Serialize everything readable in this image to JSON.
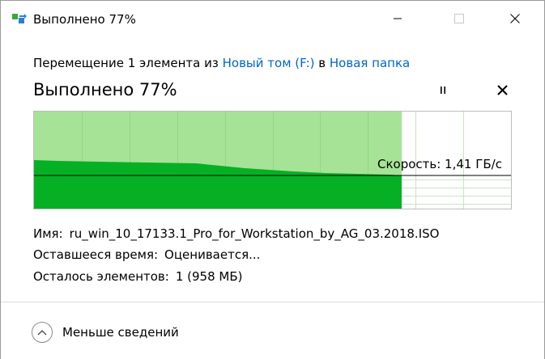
{
  "window": {
    "title": "Выполнено 77%"
  },
  "header": {
    "prefix": "Перемещение 1 элемента из ",
    "source": "Новый том (F:)",
    "middle": " в ",
    "destination": "Новая папка",
    "progress_title": "Выполнено 77%",
    "link_color": "#0066cc"
  },
  "graph": {
    "percent_complete": 77,
    "speed_label": "Скорость: 1,41 ГБ/с",
    "colors": {
      "completed_bg": "#a6e396",
      "speed_fill": "#06b025",
      "pending_bg": "#ffffff",
      "grid": "#c7e6c0",
      "speed_line": "#000000"
    }
  },
  "details": {
    "name_label": "Имя:",
    "name_value": "ru_win_10_17133.1_Pro_for_Workstation_by_AG_03.2018.ISO",
    "time_label": "Оставшееся время:",
    "time_value": "Оценивается...",
    "items_label": "Осталось элементов:",
    "items_value": "1 (958 МБ)"
  },
  "footer": {
    "toggle_label": "Меньше сведений"
  },
  "icons": {
    "app": "file-move-icon",
    "minimize": "minimize-icon",
    "maximize": "maximize-icon",
    "close": "close-icon",
    "pause": "pause-icon",
    "cancel": "cancel-icon",
    "collapse": "chevron-up-icon"
  }
}
